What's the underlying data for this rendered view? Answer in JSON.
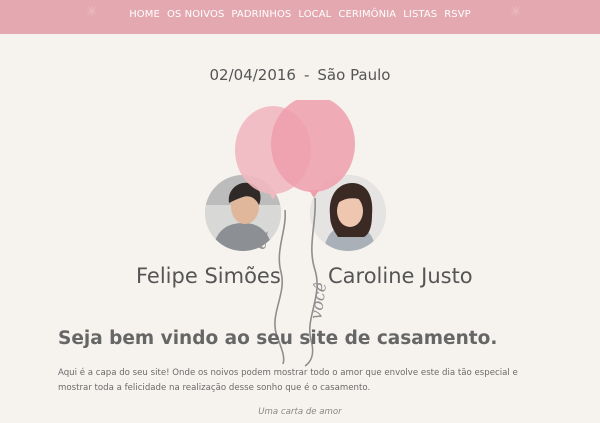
{
  "nav": {
    "items": [
      {
        "label": "HOME"
      },
      {
        "label": "OS NOIVOS"
      },
      {
        "label": "PADRINHOS"
      },
      {
        "label": "LOCAL"
      },
      {
        "label": "CERIMÔNIA"
      },
      {
        "label": "LISTAS"
      },
      {
        "label": "RSVP"
      }
    ]
  },
  "event": {
    "date": "02/04/2016",
    "separator": "-",
    "city": "São Paulo"
  },
  "couple": {
    "groom_name": "Felipe Simões",
    "bride_name": "Caroline Justo",
    "balloon_text_left": "eu",
    "balloon_text_right": "você"
  },
  "welcome": {
    "heading": "Seja bem vindo ao seu site de casamento.",
    "body": "Aqui é a capa do seu site! Onde os noivos podem mostrar todo o amor que envolve este dia tão especial e mostrar toda a felicidade na realização desse sonho que é o casamento.",
    "letter_link": "Uma carta de amor"
  },
  "colors": {
    "nav_background": "#e4a9b0",
    "balloon_left": "#f2b8c0",
    "balloon_right": "#ee9fab",
    "page_background": "#f6f3ef"
  }
}
